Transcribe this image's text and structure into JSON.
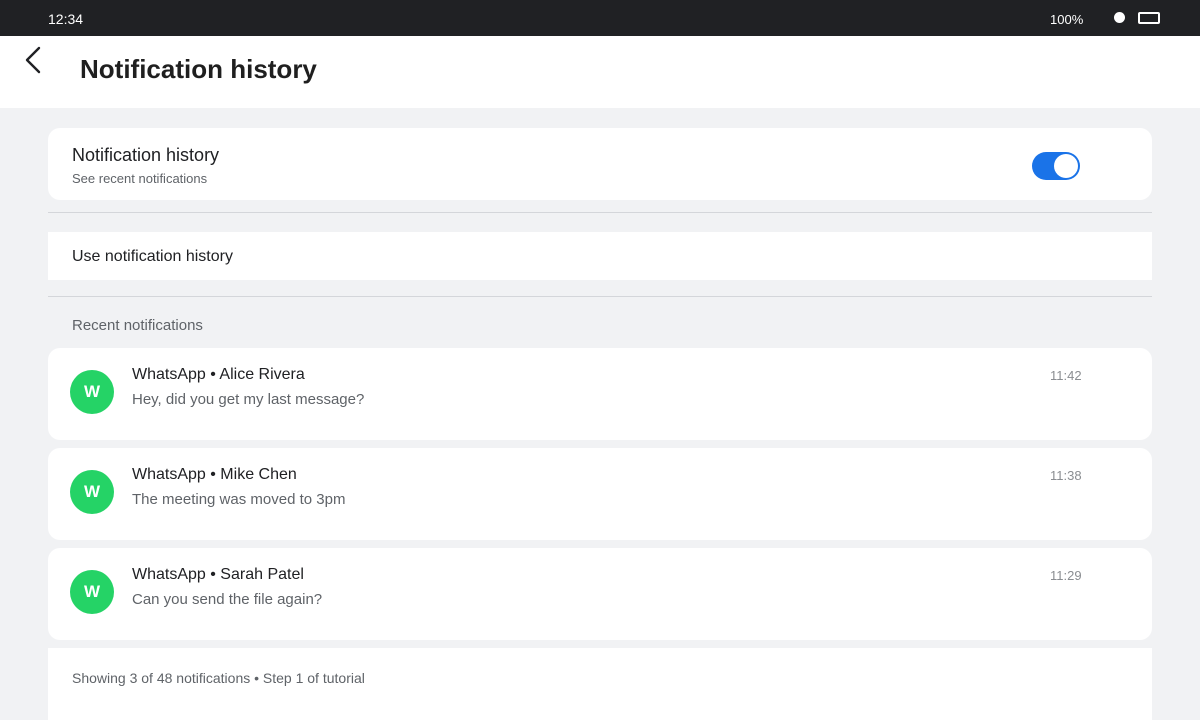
{
  "status_bar": {
    "time": "12:34",
    "battery": "100%",
    "icons": [
      "status-dot-icon",
      "battery-icon"
    ]
  },
  "app_bar": {
    "back_icon": "chevron-left-icon",
    "title": "Notification history"
  },
  "toggle_setting": {
    "title": "Notification history",
    "subtitle": "See recent notifications",
    "enabled": true,
    "accent_color": "#1a73e8"
  },
  "use_setting": {
    "label": "Use notification history"
  },
  "recent": {
    "label": "Recent notifications",
    "items": [
      {
        "avatar": "W",
        "title": "WhatsApp • Alice Rivera",
        "body": "Hey, did you get my last message?",
        "time": "11:42"
      },
      {
        "avatar": "W",
        "title": "WhatsApp • Mike Chen",
        "body": "The meeting was moved to 3pm",
        "time": "11:38"
      },
      {
        "avatar": "W",
        "title": "WhatsApp • Sarah Patel",
        "body": "Can you send the file again?",
        "time": "11:29"
      }
    ],
    "avatar_color": "#25d366"
  },
  "footer": {
    "text": "Showing 3 of 48 notifications • Step 1 of tutorial"
  }
}
